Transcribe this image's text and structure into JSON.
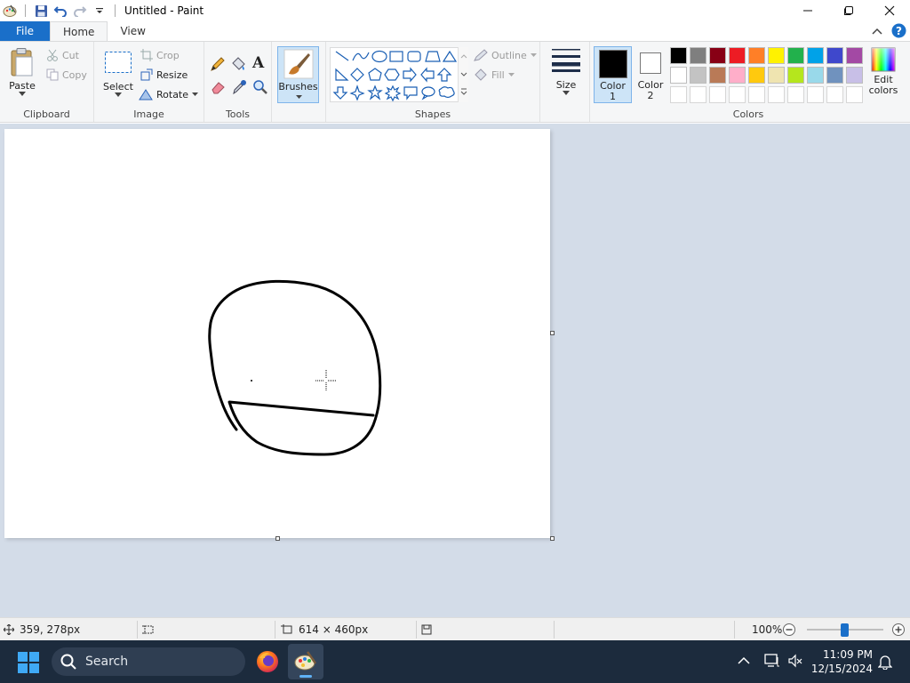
{
  "window": {
    "title": "Untitled - Paint"
  },
  "tabs": {
    "file": "File",
    "home": "Home",
    "view": "View"
  },
  "ribbon": {
    "clipboard": {
      "label": "Clipboard",
      "paste": "Paste",
      "cut": "Cut",
      "copy": "Copy"
    },
    "image": {
      "label": "Image",
      "select": "Select",
      "crop": "Crop",
      "resize": "Resize",
      "rotate": "Rotate"
    },
    "tools": {
      "label": "Tools"
    },
    "brushes": {
      "label": "Brushes"
    },
    "shapes": {
      "label": "Shapes",
      "outline": "Outline",
      "fill": "Fill"
    },
    "size": {
      "label": "Size"
    },
    "color1": {
      "label_line1": "Color",
      "label_line2": "1",
      "value": "#000000"
    },
    "color2": {
      "label_line1": "Color",
      "label_line2": "2",
      "value": "#ffffff"
    },
    "colors": {
      "label": "Colors",
      "edit_line1": "Edit",
      "edit_line2": "colors",
      "row1": [
        "#000000",
        "#7f7f7f",
        "#880015",
        "#ed1c24",
        "#ff7f27",
        "#fff200",
        "#22b14c",
        "#00a2e8",
        "#3f48cc",
        "#a349a4"
      ],
      "row2": [
        "#ffffff",
        "#c3c3c3",
        "#b97a57",
        "#ffaec9",
        "#ffc90e",
        "#efe4b0",
        "#b5e61d",
        "#99d9ea",
        "#7092be",
        "#c8bfe7"
      ],
      "row3": [
        "#ffffff",
        "#ffffff",
        "#ffffff",
        "#ffffff",
        "#ffffff",
        "#ffffff",
        "#ffffff",
        "#ffffff",
        "#ffffff",
        "#ffffff"
      ]
    }
  },
  "status": {
    "cursor_pos": "359, 278px",
    "canvas_size": "614 × 460px",
    "zoom": "100%"
  },
  "taskbar": {
    "search_placeholder": "Search",
    "time": "11:09 PM",
    "date": "12/15/2024"
  },
  "accent": "#1a6fc9"
}
